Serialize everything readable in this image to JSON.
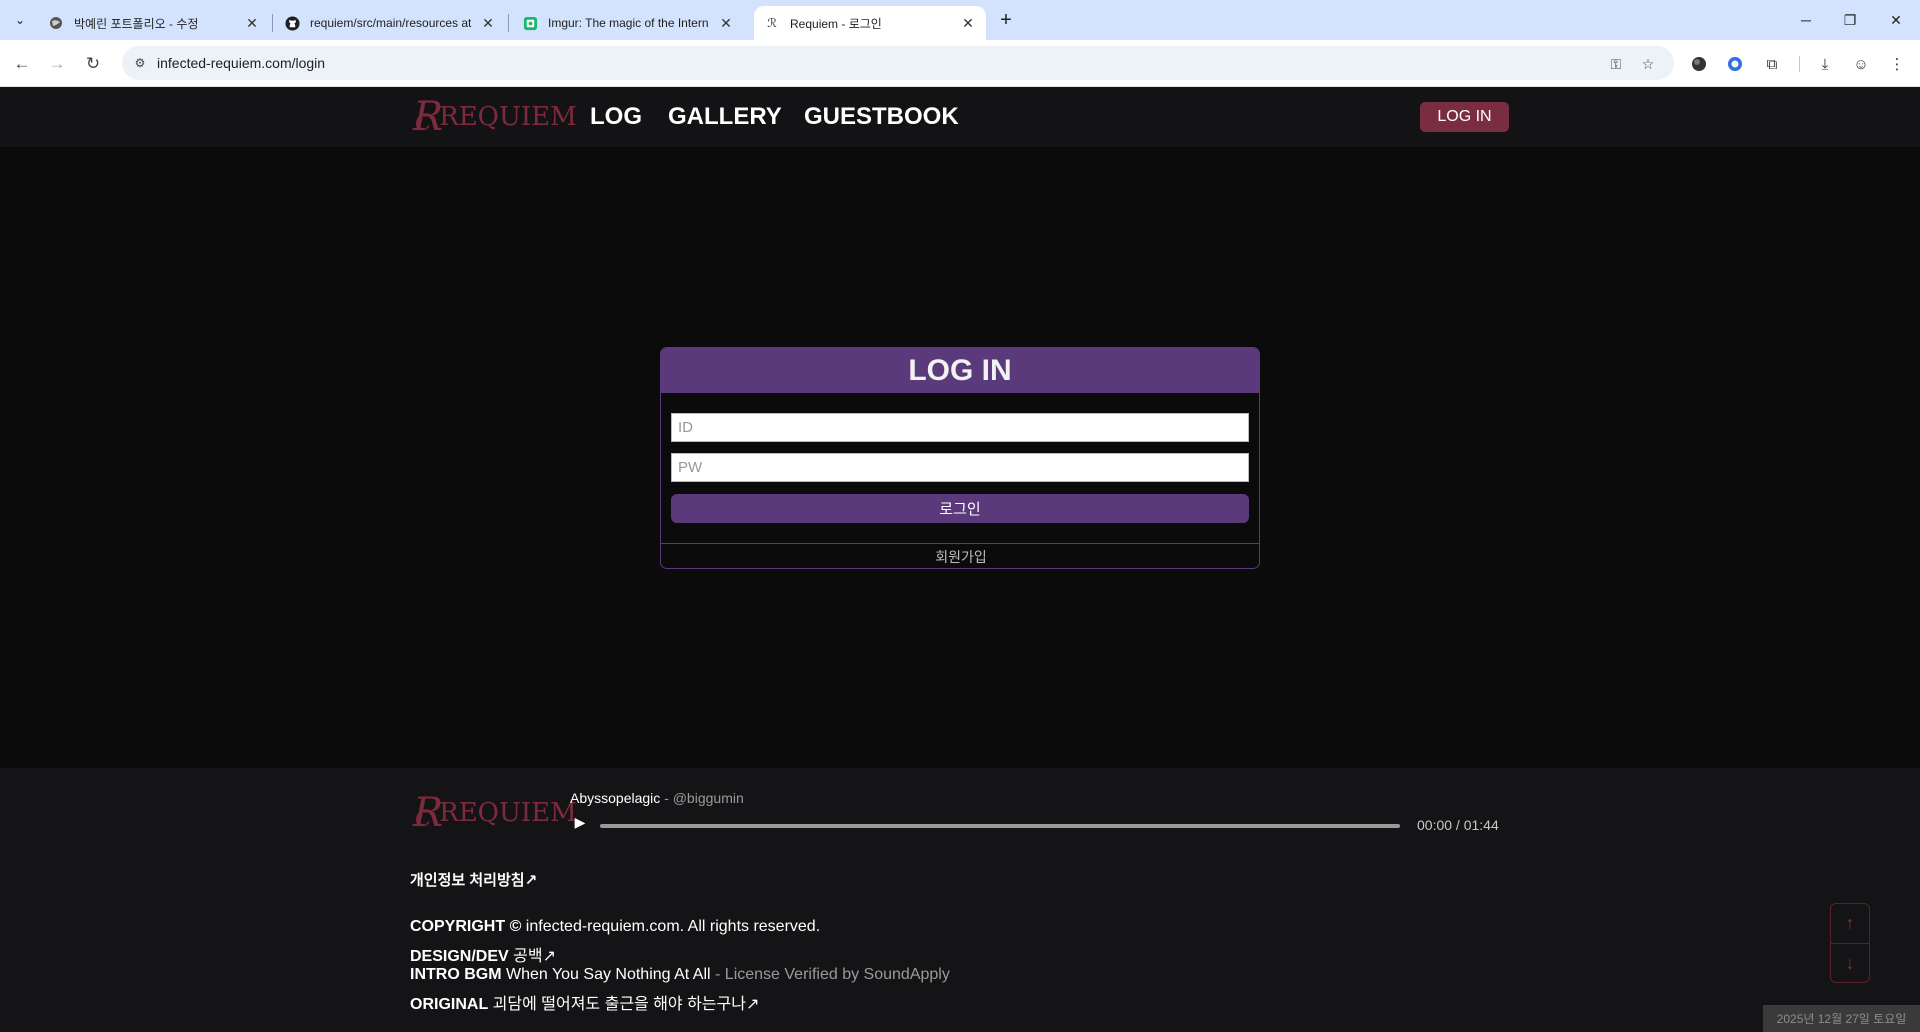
{
  "browser": {
    "tabs": [
      {
        "title": "박예린 포트폴리오 - 수정",
        "icon": "globe-icon"
      },
      {
        "title": "requiem/src/main/resources at",
        "icon": "github-icon"
      },
      {
        "title": "Imgur: The magic of the Intern",
        "icon": "imgur-icon"
      },
      {
        "title": "Requiem - 로그인",
        "icon": "requiem-favicon"
      }
    ],
    "url": "infected-requiem.com/login"
  },
  "site": {
    "logo_text": "REQUIEM",
    "logo_mark": "R",
    "nav": [
      "LOG",
      "GALLERY",
      "GUESTBOOK"
    ],
    "header_login": "LOG IN"
  },
  "login": {
    "title": "LOG IN",
    "id_placeholder": "ID",
    "pw_placeholder": "PW",
    "submit": "로그인",
    "signup": "회원가입"
  },
  "footer": {
    "player": {
      "track": "Abyssopelagic",
      "artist": " - @biggumin",
      "time": "00:00 / 01:44",
      "progress": 0
    },
    "privacy": "개인정보 처리방침↗",
    "copyright_label": "COPYRIGHT ©",
    "copyright_text": " infected-requiem.com. All rights reserved.",
    "design_label": "DESIGN/DEV",
    "design_text": " 공백↗",
    "bgm_label": "INTRO BGM",
    "bgm_text": " When You Say Nothing At All",
    "bgm_license": " - License Verified by SoundApply",
    "original_label": "ORIGINAL",
    "original_text": " 괴담에 떨어져도 출근을 해야 하는구나↗"
  },
  "overlay": {
    "date": "2025년 12월 27일 토요일"
  },
  "colors": {
    "brand_red": "#7a2c40",
    "brand_purple": "#5b3a7b",
    "background": "#0b0b0c"
  }
}
